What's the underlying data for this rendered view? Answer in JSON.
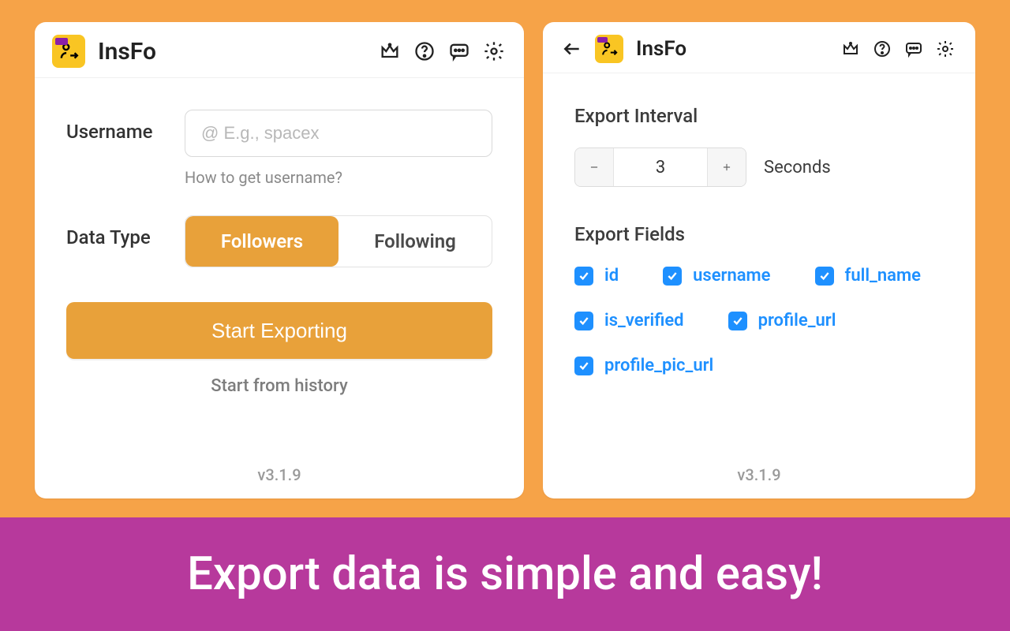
{
  "app": {
    "title": "InsFo",
    "version": "v3.1.9"
  },
  "main": {
    "username_label": "Username",
    "username_placeholder": "@ E.g., spacex",
    "username_hint": "How to get username?",
    "datatype_label": "Data Type",
    "datatype_options": {
      "followers": "Followers",
      "following": "Following"
    },
    "start_button": "Start Exporting",
    "history_link": "Start from history"
  },
  "settings": {
    "interval_title": "Export Interval",
    "interval_value": "3",
    "interval_unit": "Seconds",
    "fields_title": "Export Fields",
    "fields": {
      "id": "id",
      "username": "username",
      "full_name": "full_name",
      "is_verified": "is_verified",
      "profile_url": "profile_url",
      "profile_pic_url": "profile_pic_url"
    }
  },
  "banner": {
    "text": "Export data is simple and easy!"
  }
}
